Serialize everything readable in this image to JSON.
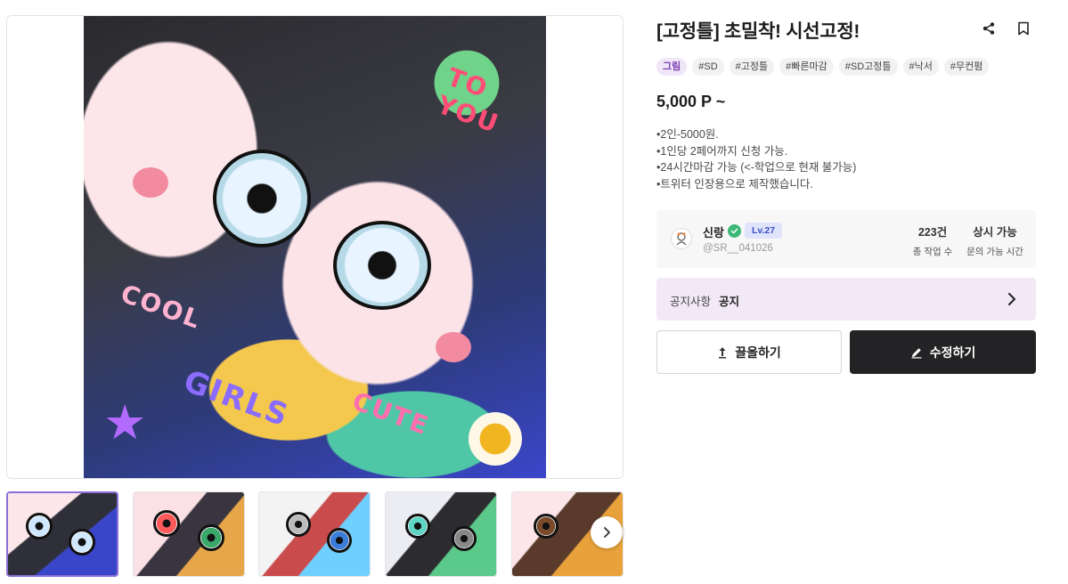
{
  "product": {
    "title": "[고정틀] 초밀착! 시선고정!",
    "price": "5,000 P ~",
    "tags": [
      {
        "label": "그림",
        "kind": "category"
      },
      {
        "label": "#SD",
        "kind": "hashtag"
      },
      {
        "label": "#고정틀",
        "kind": "hashtag"
      },
      {
        "label": "#빠른마감",
        "kind": "hashtag"
      },
      {
        "label": "#SD고정틀",
        "kind": "hashtag"
      },
      {
        "label": "#낙서",
        "kind": "hashtag"
      },
      {
        "label": "#무컨펌",
        "kind": "hashtag"
      }
    ],
    "description": [
      "•2인-5000원.",
      "•1인당 2페어까지 신청 가능.",
      "•24시간마감 가능 (<-학업으로 현재 불가능)",
      "•트위터 인장용으로 제작했습니다."
    ]
  },
  "main_image": {
    "heart_text_top": "TO YOU",
    "heart_text_bottom": "GIRLS",
    "sticker_text_left": "COOL",
    "sticker_text_right": "CUTE"
  },
  "seller": {
    "name": "신랑",
    "level": "Lv.27",
    "handle": "@SR__041026",
    "stats": [
      {
        "value": "223건",
        "label": "총 작업 수"
      },
      {
        "value": "상시 가능",
        "label": "문의 가능 시간"
      }
    ]
  },
  "notice": {
    "label": "공지사항",
    "value": "공지"
  },
  "actions": {
    "boost_label": "끌올하기",
    "edit_label": "수정하기"
  },
  "icons": {
    "share": "share-icon",
    "bookmark": "bookmark-icon",
    "next": "chevron-right-icon"
  },
  "colors": {
    "accent_purple": "#7a3cb0",
    "notice_bg": "#f1e9f5",
    "edit_button_bg": "#232325",
    "verified_green": "#3cb878",
    "level_badge_bg": "#dfe4fb"
  }
}
